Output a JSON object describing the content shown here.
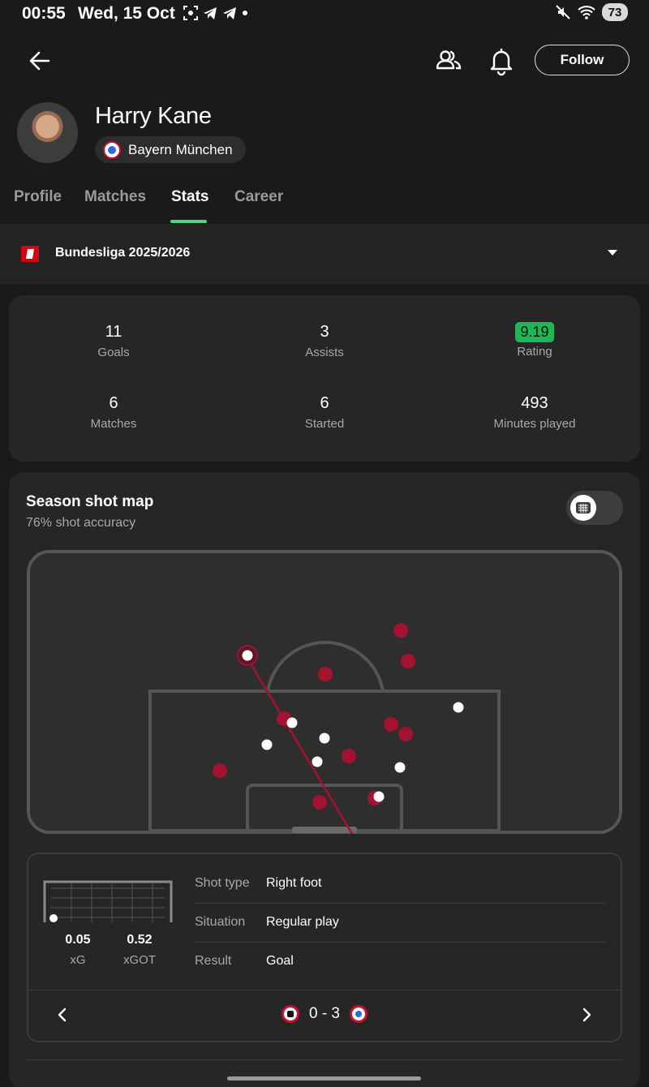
{
  "status_bar": {
    "time": "00:55",
    "date": "Wed, 15 Oct",
    "battery": "73",
    "icons_left": [
      "screenshot-icon",
      "telegram-icon",
      "telegram-icon",
      "dot-icon"
    ],
    "icons_right": [
      "mute-icon",
      "wifi-icon",
      "battery-icon"
    ]
  },
  "header": {
    "follow_label": "Follow",
    "icons": [
      "back-arrow-icon",
      "people-icon",
      "bell-icon"
    ]
  },
  "player": {
    "name": "Harry Kane",
    "club": "Bayern München"
  },
  "tabs": [
    {
      "label": "Profile",
      "active": false
    },
    {
      "label": "Matches",
      "active": false
    },
    {
      "label": "Stats",
      "active": true
    },
    {
      "label": "Career",
      "active": false
    }
  ],
  "league": {
    "name": "Bundesliga 2025/2026"
  },
  "stats": {
    "goals": {
      "value": "11",
      "label": "Goals"
    },
    "assists": {
      "value": "3",
      "label": "Assists"
    },
    "rating": {
      "value": "9.19",
      "label": "Rating"
    },
    "matches": {
      "value": "6",
      "label": "Matches"
    },
    "started": {
      "value": "6",
      "label": "Started"
    },
    "minutes": {
      "value": "493",
      "label": "Minutes played"
    }
  },
  "shot_map": {
    "title": "Season shot map",
    "subtitle": "76% shot accuracy",
    "colors": {
      "miss": "#a3122e",
      "goal": "#ffffff",
      "selected_line": "#a3122e"
    }
  },
  "shot_detail": {
    "xg_value": "0.05",
    "xg_label": "xG",
    "xgot_value": "0.52",
    "xgot_label": "xGOT",
    "rows": [
      {
        "key": "Shot type",
        "value": "Right foot"
      },
      {
        "key": "Situation",
        "value": "Regular play"
      },
      {
        "key": "Result",
        "value": "Goal"
      }
    ],
    "match_score": "0 - 3"
  },
  "colors": {
    "accent": "#4fd482",
    "rating_bg": "#1db954",
    "background": "#1a1a1a",
    "card": "#262626"
  }
}
